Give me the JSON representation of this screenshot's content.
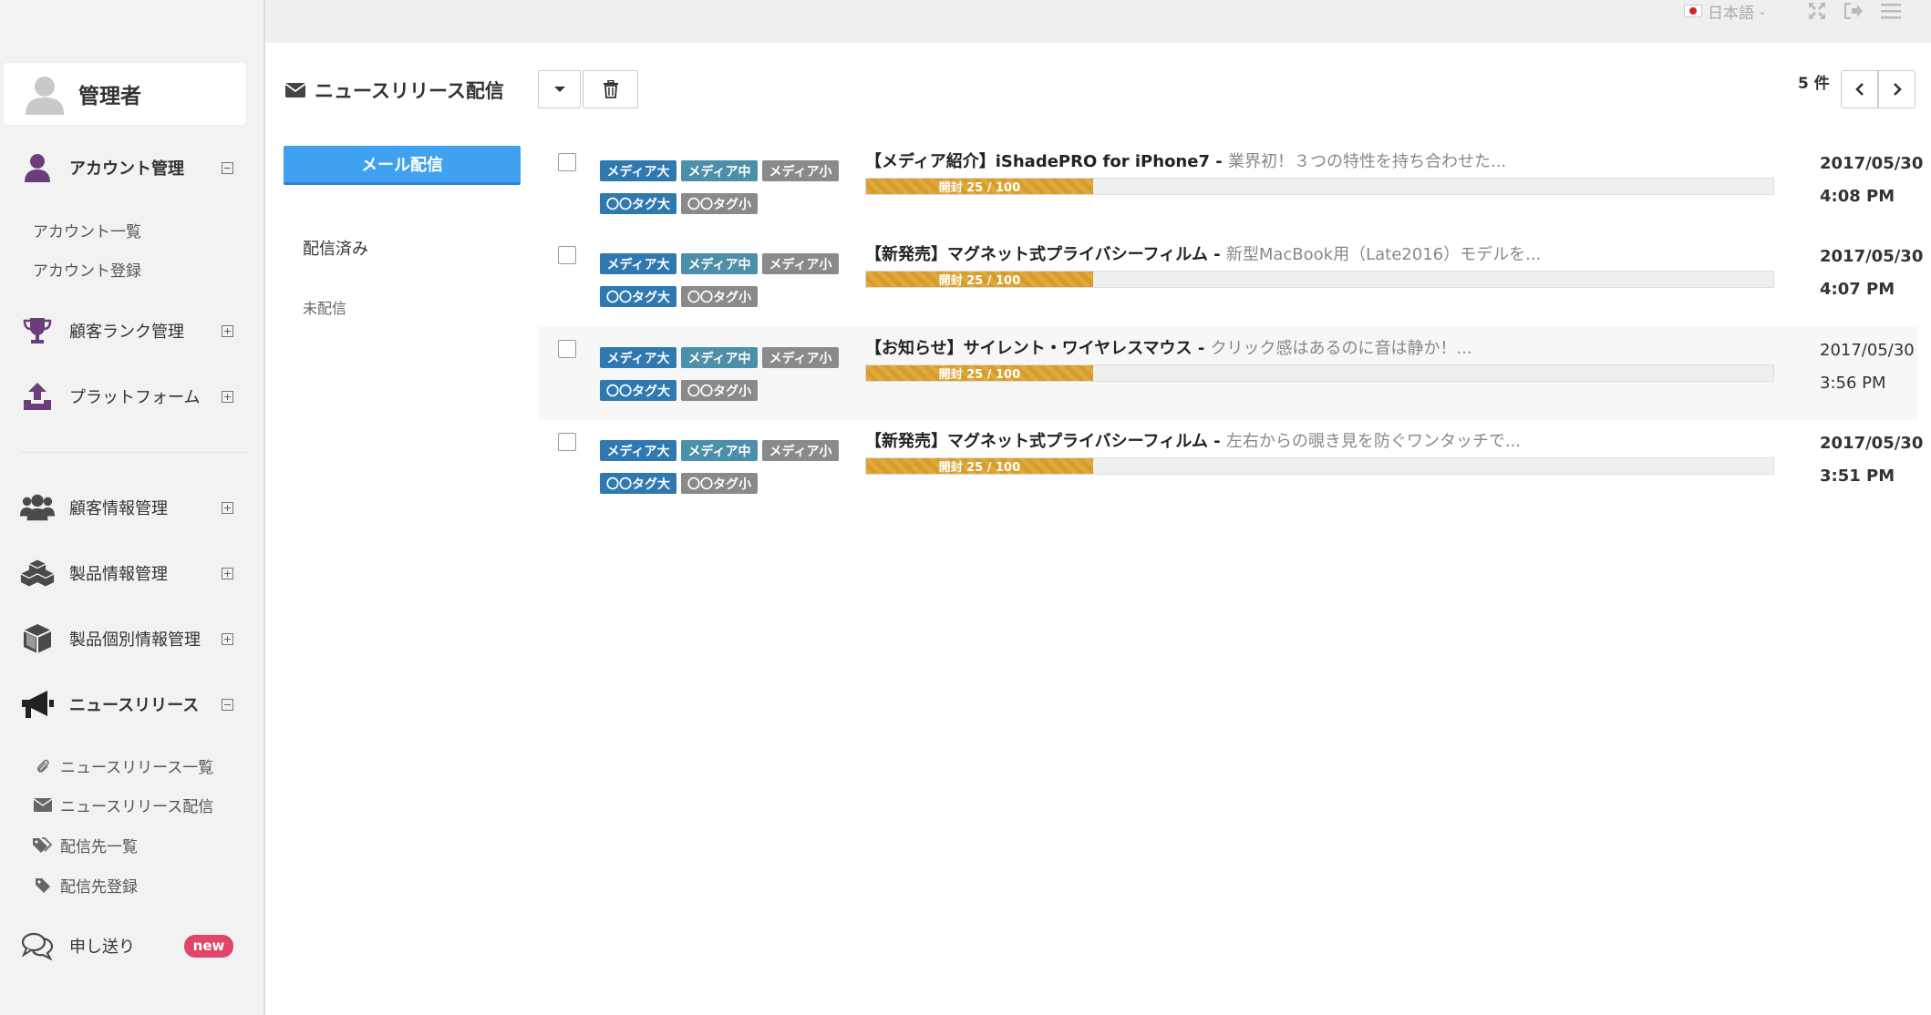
{
  "topbar": {
    "language": "日本語"
  },
  "sidebar": {
    "user_name": "管理者",
    "account": {
      "label": "アカウント管理",
      "children": [
        "アカウント一覧",
        "アカウント登録"
      ]
    },
    "rank": {
      "label": "顧客ランク管理"
    },
    "platform": {
      "label": "プラットフォーム"
    },
    "customer": {
      "label": "顧客情報管理"
    },
    "product": {
      "label": "製品情報管理"
    },
    "product_item": {
      "label": "製品個別情報管理"
    },
    "news": {
      "label": "ニュースリリース",
      "children": [
        "ニュースリリース一覧",
        "ニュースリリース配信",
        "配信先一覧",
        "配信先登録"
      ]
    },
    "memo": {
      "label": "申し送り",
      "badge": "new"
    }
  },
  "page": {
    "title": "ニュースリリース配信",
    "count_label": "5 件",
    "compose_label": "メール配信",
    "folders": [
      "配信済み",
      "未配信"
    ]
  },
  "messages": [
    {
      "tags_row1": [
        "メディア大",
        "メディア中",
        "メディア小"
      ],
      "tags_row2": [
        "〇〇タグ大",
        "〇〇タグ小"
      ],
      "title": "【メディア紹介】iShadePRO for iPhone7 - ",
      "excerpt": "業界初！３つの特性を持ち合わせた...",
      "progress_label": "開封 25 / 100",
      "progress": 0.25,
      "date": "2017/05/30",
      "time": "4:08 PM",
      "unread": true
    },
    {
      "tags_row1": [
        "メディア大",
        "メディア中",
        "メディア小"
      ],
      "tags_row2": [
        "〇〇タグ大",
        "〇〇タグ小"
      ],
      "title": "【新発売】マグネット式プライバシーフィルム - ",
      "excerpt": "新型MacBook用（Late2016）モデルを...",
      "progress_label": "開封 25 / 100",
      "progress": 0.25,
      "date": "2017/05/30",
      "time": "4:07 PM",
      "unread": true
    },
    {
      "tags_row1": [
        "メディア大",
        "メディア中",
        "メディア小"
      ],
      "tags_row2": [
        "〇〇タグ大",
        "〇〇タグ小"
      ],
      "title": "【お知らせ】サイレント・ワイヤレスマウス - ",
      "excerpt": "クリック感はあるのに音は静か！...",
      "progress_label": "開封 25 / 100",
      "progress": 0.25,
      "date": "2017/05/30",
      "time": "3:56 PM",
      "unread": false
    },
    {
      "tags_row1": [
        "メディア大",
        "メディア中",
        "メディア小"
      ],
      "tags_row2": [
        "〇〇タグ大",
        "〇〇タグ小"
      ],
      "title": "【新発売】マグネット式プライバシーフィルム - ",
      "excerpt": "左右からの覗き見を防ぐワンタッチで...",
      "progress_label": "開封 25 / 100",
      "progress": 0.25,
      "date": "2017/05/30",
      "time": "3:51 PM",
      "unread": true
    }
  ],
  "colors": {
    "accent": "#3fa1f0",
    "nav_icon": "#6b3d7a",
    "progress": "#e1a93a",
    "tag_blue": "#2f78b0",
    "tag_steel": "#4c8fa9",
    "tag_gray": "#8a8a8a",
    "badge": "#e0456a"
  },
  "icons": {
    "profile": "user-icon",
    "account": "user-icon",
    "rank": "trophy-icon",
    "platform": "upload-icon",
    "customer": "users-icon",
    "product": "cubes-icon",
    "product_item": "cube-icon",
    "news": "megaphone-icon",
    "memo": "comments-icon"
  }
}
